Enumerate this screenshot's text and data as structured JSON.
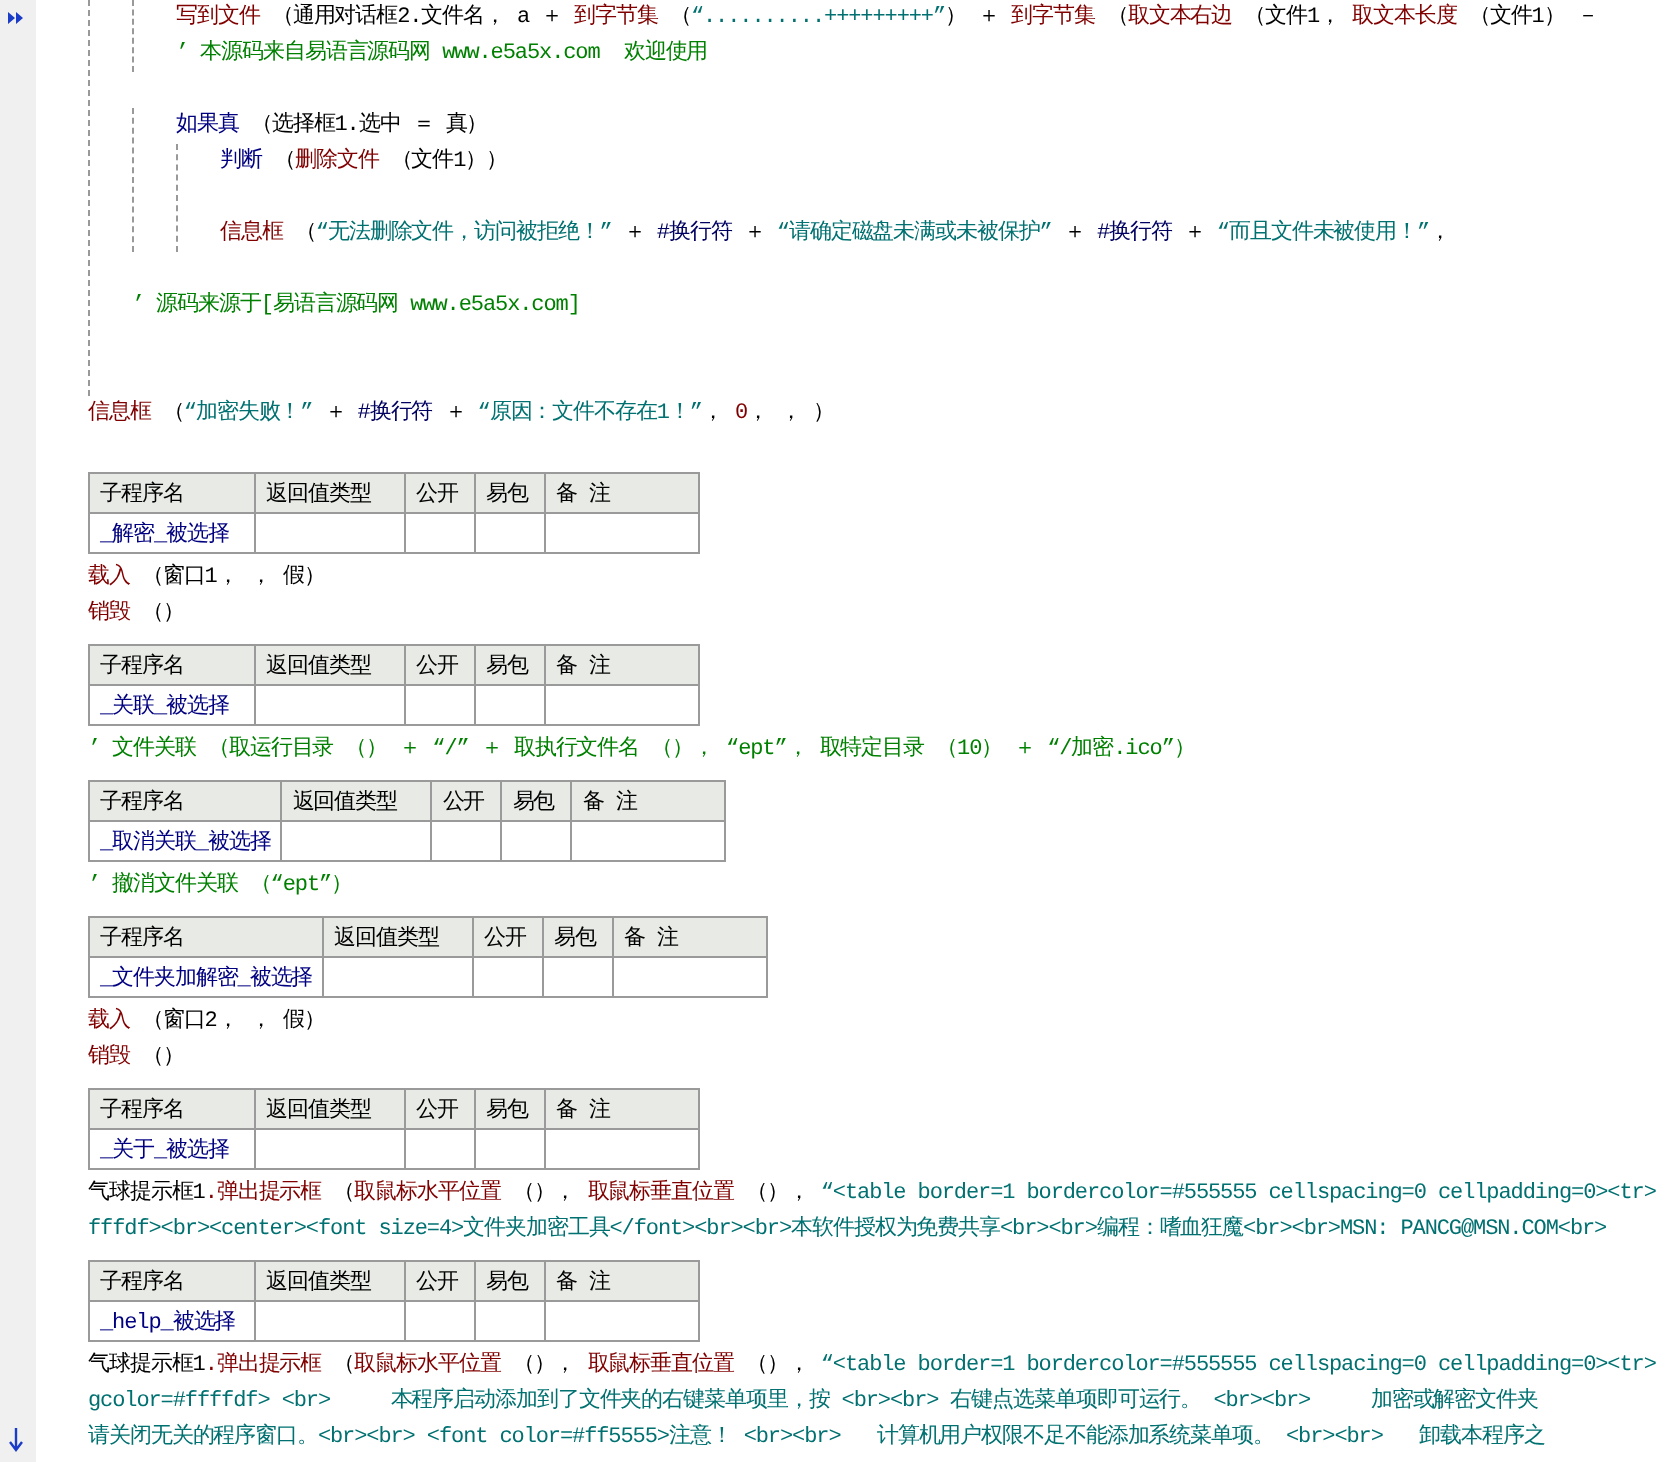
{
  "code": [
    {
      "kind": "block",
      "children": [
        {
          "kind": "block",
          "children": [
            {
              "kind": "line",
              "tokens": [
                {
                  "kind": "cmd",
                  "text": "写到文件"
                },
                {
                  "kind": "text",
                  "text": " （通用对话框2.文件名， a ＋ "
                },
                {
                  "kind": "cmd",
                  "text": "到字节集"
                },
                {
                  "kind": "text",
                  "text": " （"
                },
                {
                  "kind": "str",
                  "text": "“..........+++++++++”"
                },
                {
                  "kind": "text",
                  "text": "） ＋ "
                },
                {
                  "kind": "cmd",
                  "text": "到字节集"
                },
                {
                  "kind": "text",
                  "text": " （"
                },
                {
                  "kind": "cmd",
                  "text": "取文本右边"
                },
                {
                  "kind": "text",
                  "text": " （文件1， "
                },
                {
                  "kind": "cmd",
                  "text": "取文本长度"
                },
                {
                  "kind": "text",
                  "text": " （文件1） －"
                }
              ]
            },
            {
              "kind": "line",
              "tokens": [
                {
                  "kind": "comment",
                  "text": "’ 本源码来自易语言源码网 www.e5a5x.com  欢迎使用"
                }
              ]
            }
          ]
        },
        {
          "kind": "blank"
        },
        {
          "kind": "block",
          "children": [
            {
              "kind": "line",
              "tokens": [
                {
                  "kind": "flow",
                  "text": "如果真"
                },
                {
                  "kind": "text",
                  "text": " （选择框1.选中 ＝ 真）"
                }
              ]
            },
            {
              "kind": "block",
              "children": [
                {
                  "kind": "line",
                  "tokens": [
                    {
                      "kind": "flow",
                      "text": "判断"
                    },
                    {
                      "kind": "text",
                      "text": " （"
                    },
                    {
                      "kind": "cmd",
                      "text": "删除文件"
                    },
                    {
                      "kind": "text",
                      "text": " （文件1））"
                    }
                  ]
                },
                {
                  "kind": "blank"
                },
                {
                  "kind": "line",
                  "tokens": [
                    {
                      "kind": "cmd",
                      "text": "信息框"
                    },
                    {
                      "kind": "text",
                      "text": " （"
                    },
                    {
                      "kind": "str",
                      "text": "“无法删除文件，访问被拒绝！”"
                    },
                    {
                      "kind": "text",
                      "text": " ＋ "
                    },
                    {
                      "kind": "const",
                      "text": "#换行符"
                    },
                    {
                      "kind": "text",
                      "text": " ＋ "
                    },
                    {
                      "kind": "str",
                      "text": "“请确定磁盘未满或未被保护”"
                    },
                    {
                      "kind": "text",
                      "text": " ＋ "
                    },
                    {
                      "kind": "const",
                      "text": "#换行符"
                    },
                    {
                      "kind": "text",
                      "text": " ＋ "
                    },
                    {
                      "kind": "str",
                      "text": "“而且文件未被使用！”"
                    },
                    {
                      "kind": "text",
                      "text": "，"
                    }
                  ]
                }
              ]
            }
          ]
        },
        {
          "kind": "blank"
        },
        {
          "kind": "line",
          "tokens": [
            {
              "kind": "comment",
              "text": "’ 源码来源于[易语言源码网 www.e5a5x.com]"
            }
          ]
        },
        {
          "kind": "blank"
        },
        {
          "kind": "blank"
        }
      ]
    },
    {
      "kind": "line",
      "tokens": [
        {
          "kind": "cmd",
          "text": "信息框"
        },
        {
          "kind": "text",
          "text": " （"
        },
        {
          "kind": "str",
          "text": "“加密失败！”"
        },
        {
          "kind": "text",
          "text": " ＋ "
        },
        {
          "kind": "const",
          "text": "#换行符"
        },
        {
          "kind": "text",
          "text": " ＋ "
        },
        {
          "kind": "str",
          "text": "“原因：文件不存在1！”"
        },
        {
          "kind": "text",
          "text": "， "
        },
        {
          "kind": "num",
          "text": "0"
        },
        {
          "kind": "text",
          "text": "， ， ）"
        }
      ]
    }
  ],
  "subroutines": [
    {
      "table": {
        "headers": [
          "子程序名",
          "返回值类型",
          "公开",
          "易包",
          "备 注"
        ],
        "name": "_解密_被选择"
      },
      "lines": [
        [
          {
            "kind": "cmd",
            "text": "载入"
          },
          {
            "kind": "text",
            "text": " （窗口1， ， 假）"
          }
        ],
        [
          {
            "kind": "cmd",
            "text": "销毁"
          },
          {
            "kind": "text",
            "text": " （）"
          }
        ]
      ]
    },
    {
      "table": {
        "headers": [
          "子程序名",
          "返回值类型",
          "公开",
          "易包",
          "备 注"
        ],
        "name": "_关联_被选择"
      },
      "lines": [
        [
          {
            "kind": "comment",
            "text": "’ 文件关联 （取运行目录 （） ＋ “/” ＋ 取执行文件名 （）， “ept”， 取特定目录 （10） ＋ “/加密.ico”）"
          }
        ]
      ]
    },
    {
      "table": {
        "headers": [
          "子程序名",
          "返回值类型",
          "公开",
          "易包",
          "备 注"
        ],
        "name": "_取消关联_被选择"
      },
      "lines": [
        [
          {
            "kind": "comment",
            "text": "’ 撤消文件关联 （“ept”）"
          }
        ]
      ]
    },
    {
      "table": {
        "headers": [
          "子程序名",
          "返回值类型",
          "公开",
          "易包",
          "备 注"
        ],
        "name": "_文件夹加解密_被选择"
      },
      "lines": [
        [
          {
            "kind": "cmd",
            "text": "载入"
          },
          {
            "kind": "text",
            "text": " （窗口2， ， 假）"
          }
        ],
        [
          {
            "kind": "cmd",
            "text": "销毁"
          },
          {
            "kind": "text",
            "text": " （）"
          }
        ]
      ]
    },
    {
      "table": {
        "headers": [
          "子程序名",
          "返回值类型",
          "公开",
          "易包",
          "备 注"
        ],
        "name": "_关于_被选择"
      },
      "lines": [
        [
          {
            "kind": "text",
            "text": "气球提示框1"
          },
          {
            "kind": "cmd",
            "text": ".弹出提示框"
          },
          {
            "kind": "text",
            "text": " （"
          },
          {
            "kind": "cmd",
            "text": "取鼠标水平位置"
          },
          {
            "kind": "text",
            "text": " （）， "
          },
          {
            "kind": "cmd",
            "text": "取鼠标垂直位置"
          },
          {
            "kind": "text",
            "text": " （）， "
          },
          {
            "kind": "str",
            "text": "“<table border=1 bordercolor=#555555 cellspacing=0 cellpadding=0><tr>"
          }
        ],
        [
          {
            "kind": "str",
            "text": "fffdf><br><center><font size=4>文件夹加密工具</font><br><br>本软件授权为免费共享<br><br>编程：嗜血狂魔<br><br>MSN: PANCG@MSN.COM<br>"
          }
        ]
      ]
    },
    {
      "table": {
        "headers": [
          "子程序名",
          "返回值类型",
          "公开",
          "易包",
          "备 注"
        ],
        "name": "_help_被选择"
      },
      "lines": [
        [
          {
            "kind": "text",
            "text": "气球提示框1"
          },
          {
            "kind": "cmd",
            "text": ".弹出提示框"
          },
          {
            "kind": "text",
            "text": " （"
          },
          {
            "kind": "cmd",
            "text": "取鼠标水平位置"
          },
          {
            "kind": "text",
            "text": " （）， "
          },
          {
            "kind": "cmd",
            "text": "取鼠标垂直位置"
          },
          {
            "kind": "text",
            "text": " （）， "
          },
          {
            "kind": "str",
            "text": "“<table border=1 bordercolor=#555555 cellspacing=0 cellpadding=0><tr>"
          }
        ],
        [
          {
            "kind": "str",
            "text": "gcolor=#ffffdf> <br>     本程序启动添加到了文件夹的右键菜单项里，按 <br><br> 右键点选菜单项即可运行。 <br><br>     加密或解密文件夹"
          }
        ],
        [
          {
            "kind": "str",
            "text": "请关闭无关的程序窗口。<br><br> <font color=#ff5555>注意！ <br><br>   计算机用户权限不足不能添加系统菜单项。 <br><br>   卸载本程序之"
          }
        ]
      ]
    }
  ]
}
